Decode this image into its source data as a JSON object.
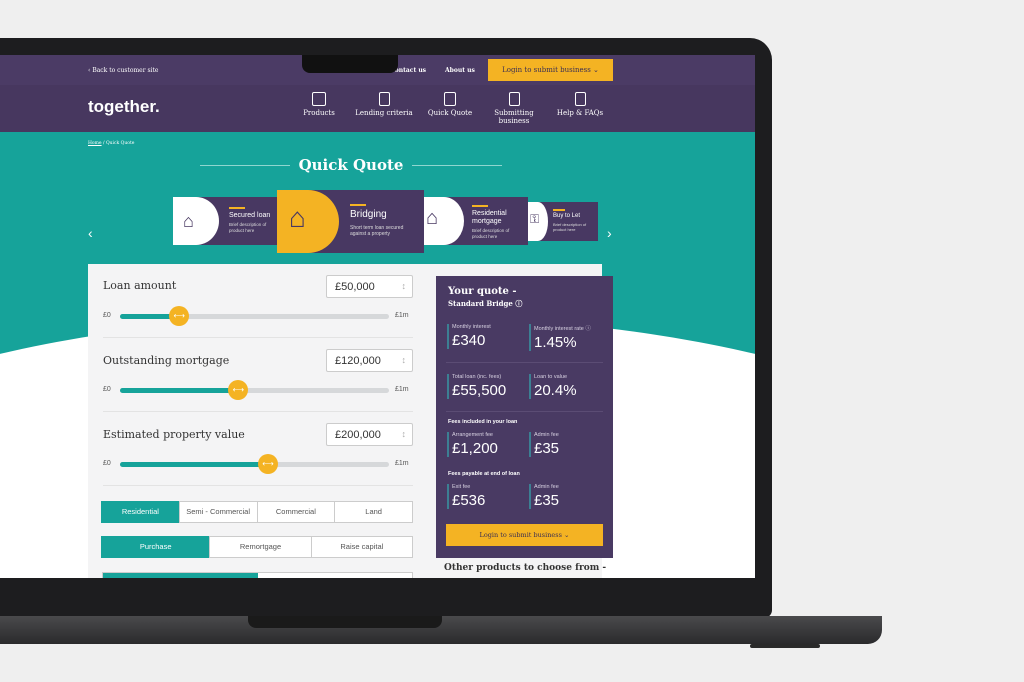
{
  "topbar": {
    "back_link": "Back to customer site",
    "contact": "Contact us",
    "about": "About us",
    "login_button": "Login to submit business"
  },
  "nav": {
    "logo": "together.",
    "items": [
      {
        "label": "Products",
        "icon": "briefcase-icon"
      },
      {
        "label": "Lending criteria",
        "icon": "document-icon"
      },
      {
        "label": "Quick Quote",
        "icon": "calculator-icon"
      },
      {
        "label": "Submitting business",
        "icon": "submit-icon"
      },
      {
        "label": "Help & FAQs",
        "icon": "help-icon"
      }
    ]
  },
  "breadcrumb": {
    "home": "Home",
    "current": "Quick Quote"
  },
  "page_title": "Quick Quote",
  "products": [
    {
      "title": "Secured loan",
      "desc": "Brief description of product here",
      "icon": "house-lock-icon"
    },
    {
      "title": "Bridging",
      "desc": "Short term loan secured against a property",
      "icon": "houses-icon",
      "selected": true
    },
    {
      "title": "Residential mortgage",
      "desc": "Brief description of product here",
      "icon": "house-icon"
    },
    {
      "title": "Buy to Let",
      "desc": "Brief description of product here",
      "icon": "key-icon"
    }
  ],
  "form": {
    "sliders": [
      {
        "label": "Loan amount",
        "value": "£50,000",
        "min": "£0",
        "max": "£1m",
        "fill_pct": 22
      },
      {
        "label": "Outstanding mortgage",
        "value": "£120,000",
        "min": "£0",
        "max": "£1m",
        "fill_pct": 44
      },
      {
        "label": "Estimated property value",
        "value": "£200,000",
        "min": "£0",
        "max": "£1m",
        "fill_pct": 55
      }
    ],
    "property_type": {
      "options": [
        "Residential",
        "Semi - Commercial",
        "Commercial",
        "Land"
      ],
      "selected": "Residential"
    },
    "purpose": {
      "options": [
        "Purchase",
        "Remortgage",
        "Raise capital"
      ],
      "selected": "Purchase"
    }
  },
  "quote": {
    "title": "Your quote -",
    "subtitle": "Standard Bridge",
    "monthly_interest_label": "Monthly interest",
    "monthly_interest": "£340",
    "rate_label": "Monthly interest rate",
    "rate": "1.45%",
    "total_loan_label": "Total loan (inc. fees)",
    "total_loan": "£55,500",
    "ltv_label": "Loan to value",
    "ltv": "20.4%",
    "fees_included_heading": "Fees included in your loan",
    "arrangement_label": "Arrangement fee",
    "arrangement": "£1,200",
    "admin1_label": "Admin fee",
    "admin1": "£35",
    "fees_end_heading": "Fees payable at end of loan",
    "exit_label": "Exit fee",
    "exit": "£536",
    "admin2_label": "Admin fee",
    "admin2": "£35",
    "login_button": "Login to submit business"
  },
  "other_products": "Other products to choose from -",
  "colors": {
    "purple": "#4b3b65",
    "teal": "#16a39a",
    "yellow": "#f4b323"
  }
}
